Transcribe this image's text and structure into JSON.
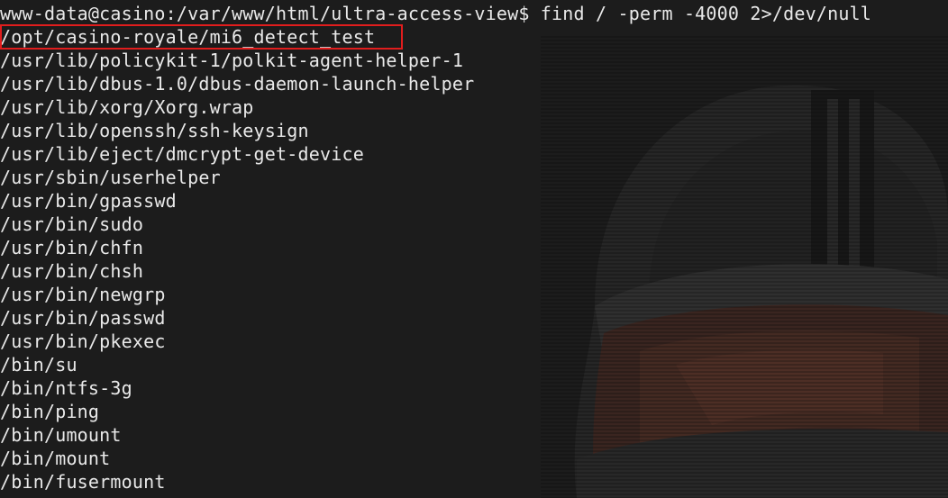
{
  "terminal": {
    "prompt_line": "www-data@casino:/var/www/html/ultra-access-view$ find / -perm -4000 2>/dev/null",
    "output": [
      "/opt/casino-royale/mi6_detect_test",
      "/usr/lib/policykit-1/polkit-agent-helper-1",
      "/usr/lib/dbus-1.0/dbus-daemon-launch-helper",
      "/usr/lib/xorg/Xorg.wrap",
      "/usr/lib/openssh/ssh-keysign",
      "/usr/lib/eject/dmcrypt-get-device",
      "/usr/sbin/userhelper",
      "/usr/bin/gpasswd",
      "/usr/bin/sudo",
      "/usr/bin/chfn",
      "/usr/bin/chsh",
      "/usr/bin/newgrp",
      "/usr/bin/passwd",
      "/usr/bin/pkexec",
      "/bin/su",
      "/bin/ntfs-3g",
      "/bin/ping",
      "/bin/umount",
      "/bin/mount",
      "/bin/fusermount"
    ],
    "highlight_color": "#e11d1d",
    "text_color": "#e9e9e9",
    "background_color": "#1c1c1c"
  }
}
